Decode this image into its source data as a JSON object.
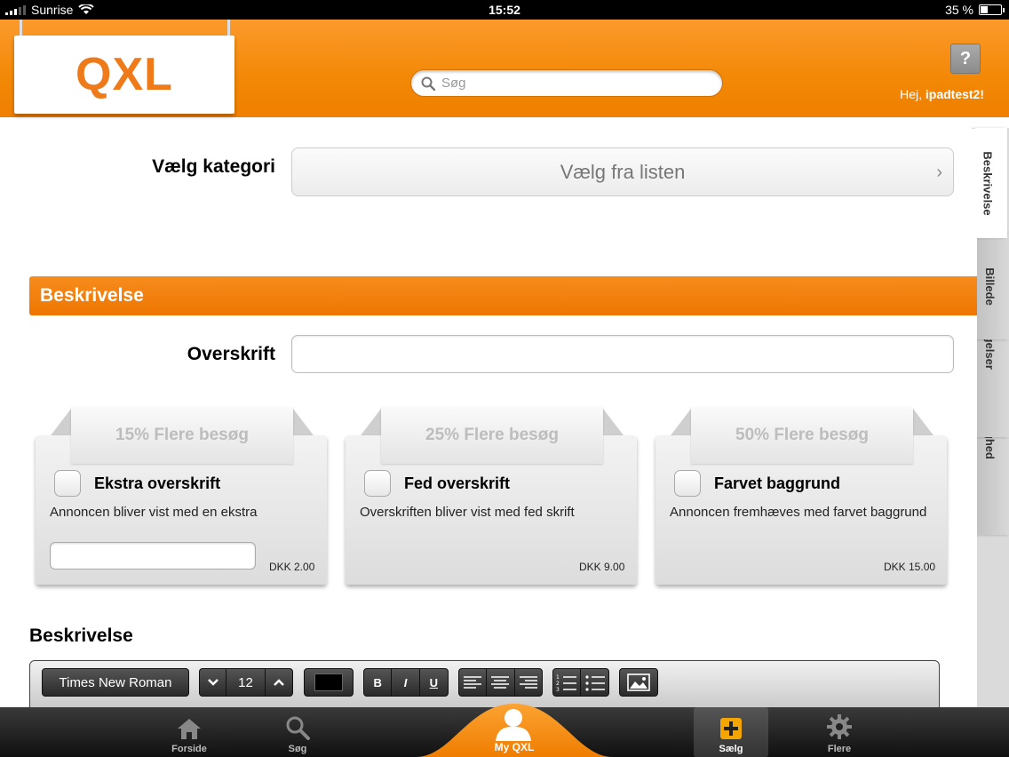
{
  "status_bar": {
    "carrier": "Sunrise",
    "time": "15:52",
    "battery": "35 %",
    "battery_level": 0.35
  },
  "header": {
    "logo": "QXL",
    "search_placeholder": "Søg",
    "help_label": "?",
    "greeting_prefix": "Hej,",
    "username": "ipadtest2!"
  },
  "category": {
    "label": "Vælg kategori",
    "select_text": "Vælg fra listen"
  },
  "description_section": {
    "title": "Beskrivelse",
    "headline_label": "Overskrift"
  },
  "options": [
    {
      "tab": "15% Flere besøg",
      "title": "Ekstra overskrift",
      "desc": "Annoncen bliver vist med en ekstra",
      "price": "DKK 2.00"
    },
    {
      "tab": "25% Flere besøg",
      "title": "Fed overskrift",
      "desc": "Overskriften bliver vist med fed skrift",
      "price": "DKK 9.00"
    },
    {
      "tab": "50% Flere besøg",
      "title": "Farvet baggrund",
      "desc": "Annoncen fremhæves med farvet baggrund",
      "price": "DKK 15.00"
    }
  ],
  "editor": {
    "label": "Beskrivelse",
    "font": "Times New Roman",
    "font_size": "12",
    "bold": "B",
    "italic": "I",
    "underline": "U",
    "text_color": "#000000"
  },
  "side_tabs": [
    "Beskrivelse",
    "Billede",
    "Betingelser",
    "Varighed"
  ],
  "tab_bar": {
    "items": [
      "Forside",
      "Søg",
      "My QXL",
      "Sælg",
      "Flere"
    ]
  },
  "colors": {
    "brand_orange": "#f18300",
    "logo_orange": "#ee7a1a"
  }
}
